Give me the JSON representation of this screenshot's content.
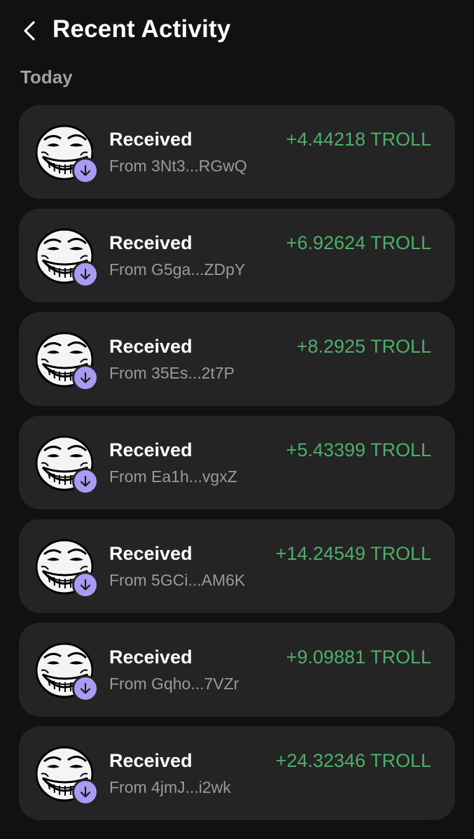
{
  "header": {
    "back_icon": "chevron-left-icon",
    "title": "Recent Activity"
  },
  "section": {
    "label": "Today"
  },
  "colors": {
    "background": "#111111",
    "card": "#242424",
    "positive_amount": "#4fae6b",
    "badge": "#a99bf4",
    "secondary_text": "#9a9a9a"
  },
  "transactions": [
    {
      "title": "Received",
      "from": "From 3Nt3...RGwQ",
      "amount": "+4.44218 TROLL",
      "avatar_icon": "trollface-token-icon",
      "badge_icon": "arrow-down-icon"
    },
    {
      "title": "Received",
      "from": "From G5ga...ZDpY",
      "amount": "+6.92624 TROLL",
      "avatar_icon": "trollface-token-icon",
      "badge_icon": "arrow-down-icon"
    },
    {
      "title": "Received",
      "from": "From 35Es...2t7P",
      "amount": "+8.2925 TROLL",
      "avatar_icon": "trollface-token-icon",
      "badge_icon": "arrow-down-icon"
    },
    {
      "title": "Received",
      "from": "From Ea1h...vgxZ",
      "amount": "+5.43399 TROLL",
      "avatar_icon": "trollface-token-icon",
      "badge_icon": "arrow-down-icon"
    },
    {
      "title": "Received",
      "from": "From 5GCi...AM6K",
      "amount": "+14.24549 TROLL",
      "avatar_icon": "trollface-token-icon",
      "badge_icon": "arrow-down-icon"
    },
    {
      "title": "Received",
      "from": "From Gqho...7VZr",
      "amount": "+9.09881 TROLL",
      "avatar_icon": "trollface-token-icon",
      "badge_icon": "arrow-down-icon"
    },
    {
      "title": "Received",
      "from": "From 4jmJ...i2wk",
      "amount": "+24.32346 TROLL",
      "avatar_icon": "trollface-token-icon",
      "badge_icon": "arrow-down-icon"
    }
  ]
}
